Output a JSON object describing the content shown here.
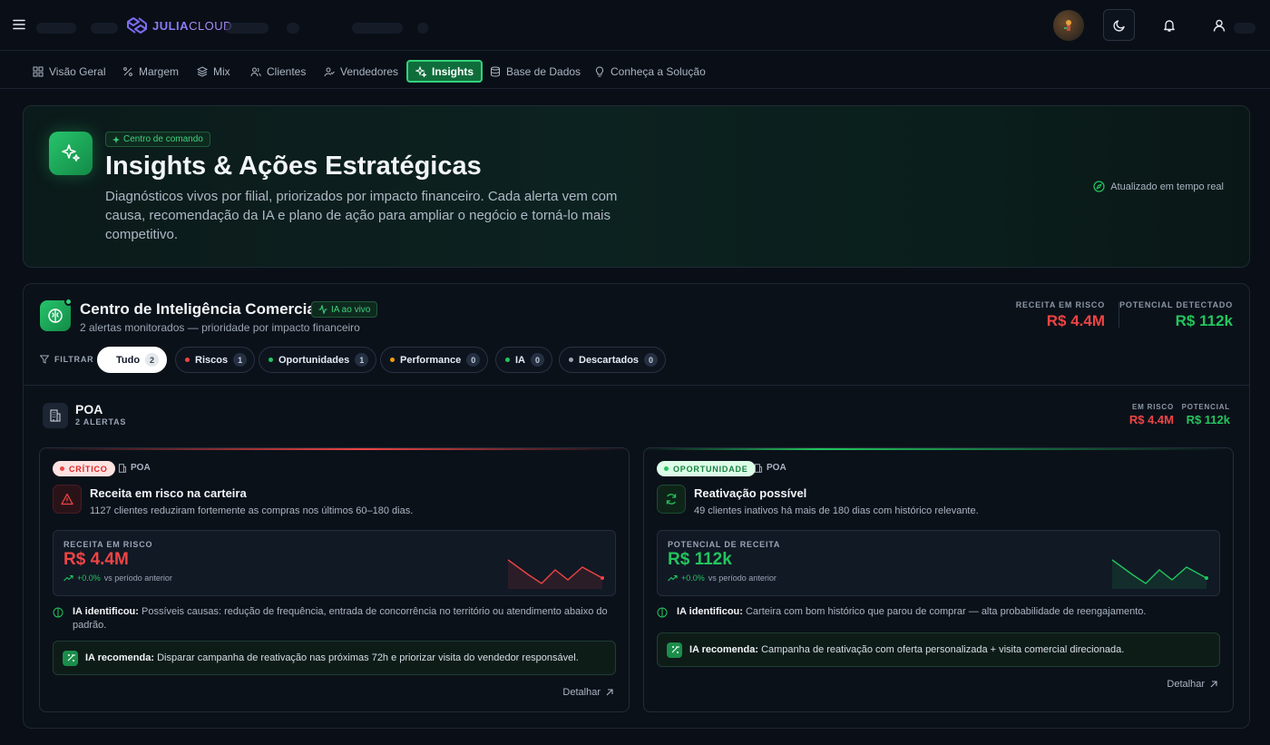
{
  "brand": {
    "name_strong": "JULIA",
    "name_light": "CLOUD"
  },
  "nav": {
    "tabs": [
      {
        "label": "Visão Geral"
      },
      {
        "label": "Margem"
      },
      {
        "label": "Mix"
      },
      {
        "label": "Clientes"
      },
      {
        "label": "Vendedores"
      },
      {
        "label": "Insights"
      },
      {
        "label": "Base de Dados"
      },
      {
        "label": "Conheça a Solução"
      }
    ]
  },
  "hero": {
    "chip": "Centro de comando",
    "title": "Insights & Ações Estratégicas",
    "description": "Diagnósticos vivos por filial, priorizados por impacto financeiro. Cada alerta vem com causa, recomendação da IA e plano de ação para ampliar o negócio e torná-lo mais competitivo.",
    "status": "Atualizado em tempo real"
  },
  "center": {
    "title": "Centro de Inteligência Comercial",
    "live_chip": "IA ao vivo",
    "subtitle": "2 alertas monitorados — prioridade por impacto financeiro",
    "kpi_risk_label": "RECEITA EM RISCO",
    "kpi_risk_value": "R$ 4.4M",
    "kpi_potential_label": "POTENCIAL DETECTADO",
    "kpi_potential_value": "R$ 112k",
    "filter_label": "FILTRAR",
    "filters": [
      {
        "label": "Tudo",
        "count": "2"
      },
      {
        "label": "Riscos",
        "count": "1"
      },
      {
        "label": "Oportunidades",
        "count": "1"
      },
      {
        "label": "Performance",
        "count": "0"
      },
      {
        "label": "IA",
        "count": "0"
      },
      {
        "label": "Descartados",
        "count": "0"
      }
    ],
    "colors": {
      "risk": "#ef4444",
      "opportunity": "#22c55e",
      "performance": "#f59e0b",
      "ia": "#22c55e",
      "discarded": "#9aa5b4"
    }
  },
  "branch": {
    "name": "POA",
    "alerts": "2 ALERTAS",
    "risk_label": "EM RISCO",
    "risk_value": "R$ 4.4M",
    "potential_label": "POTENCIAL",
    "potential_value": "R$ 112k"
  },
  "alerts": [
    {
      "badge": "CRÍTICO",
      "location": "POA",
      "title": "Receita em risco na carteira",
      "description": "1127 clientes reduziram fortemente as compras nos últimos 60–180 dias.",
      "metric_label": "RECEITA EM RISCO",
      "metric_value": "R$ 4.4M",
      "trend_pct": "+0.0%",
      "trend_text": "vs período anterior",
      "ia_identified_label": "IA identificou:",
      "ia_identified_text": "Possíveis causas: redução de frequência, entrada de concorrência no território ou atendimento abaixo do padrão.",
      "ia_recommend_label": "IA recomenda:",
      "ia_recommend_text": "Disparar campanha de reativação nas próximas 72h e priorizar visita do vendedor responsável.",
      "detail": "Detalhar",
      "color": "#ef4444"
    },
    {
      "badge": "OPORTUNIDADE",
      "location": "POA",
      "title": "Reativação possível",
      "description": "49 clientes inativos há mais de 180 dias com histórico relevante.",
      "metric_label": "POTENCIAL DE RECEITA",
      "metric_value": "R$ 112k",
      "trend_pct": "+0.0%",
      "trend_text": "vs período anterior",
      "ia_identified_label": "IA identificou:",
      "ia_identified_text": "Carteira com bom histórico que parou de comprar — alta probabilidade de reengajamento.",
      "ia_recommend_label": "IA recomenda:",
      "ia_recommend_text": "Campanha de reativação com oferta personalizada + visita comercial direcionada.",
      "detail": "Detalhar",
      "color": "#22c55e"
    }
  ]
}
